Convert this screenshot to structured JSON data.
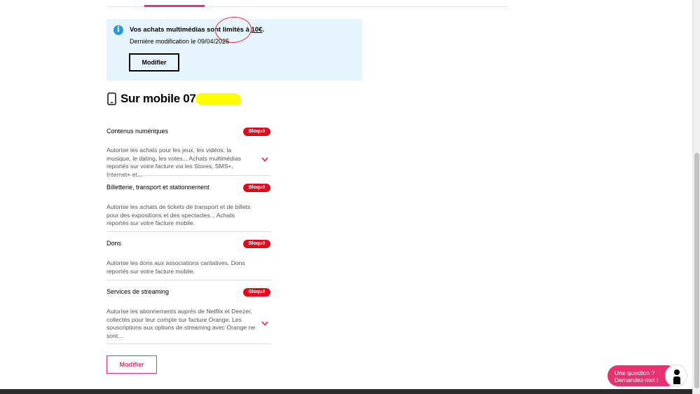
{
  "tabs": {
    "active_color": "#e6336f"
  },
  "info_box": {
    "icon": "info-icon",
    "title_prefix": "Vos achats multimédias sont limités à ",
    "title_limit": "10€",
    "title_suffix": ".",
    "last_modified": "Dernière modification le 09/04/2025",
    "button_label": "Modifier"
  },
  "mobile": {
    "icon": "smartphone-icon",
    "heading": "Sur mobile 078"
  },
  "services": [
    {
      "title": "Contenus numériques",
      "status": "Bloqué",
      "description": "Autorise les achats pour les jeux, les vidéos, la musique, le dating, les votes... Achats multimédias reportés sur votre facture via les Stores, SMS+, Internet+ et...",
      "expandable": true
    },
    {
      "title": "Billetterie, transport et stationnement",
      "status": "Bloqué",
      "description": "Autorise les achats de tickets de transport et de billets pour des expositions et des spectacles... Achats reportés sur votre facture mobile.",
      "expandable": false
    },
    {
      "title": "Dons",
      "status": "Bloqué",
      "description": "Autorise les dons aux associations caritatives. Dons reportés sur votre facture mobile.",
      "expandable": false
    },
    {
      "title": "Services de streaming",
      "status": "Bloqué",
      "description": "Autorise les abonnements auprès de Netflix et Deezer, collectés pour leur compte sur facture Orange. Les souscriptions aux options de streaming avec Orange ne sont...",
      "expandable": true
    }
  ],
  "modify_button": "Modifier",
  "chat": {
    "line1": "Une question ?",
    "line2": "Demandez-moi !",
    "avatar_icon": "assistant-avatar-icon"
  },
  "colors": {
    "accent": "#e6336f",
    "badge_red": "#e20a1a",
    "info_bg": "#e6f4fc",
    "info_icon": "#2a99d8"
  }
}
